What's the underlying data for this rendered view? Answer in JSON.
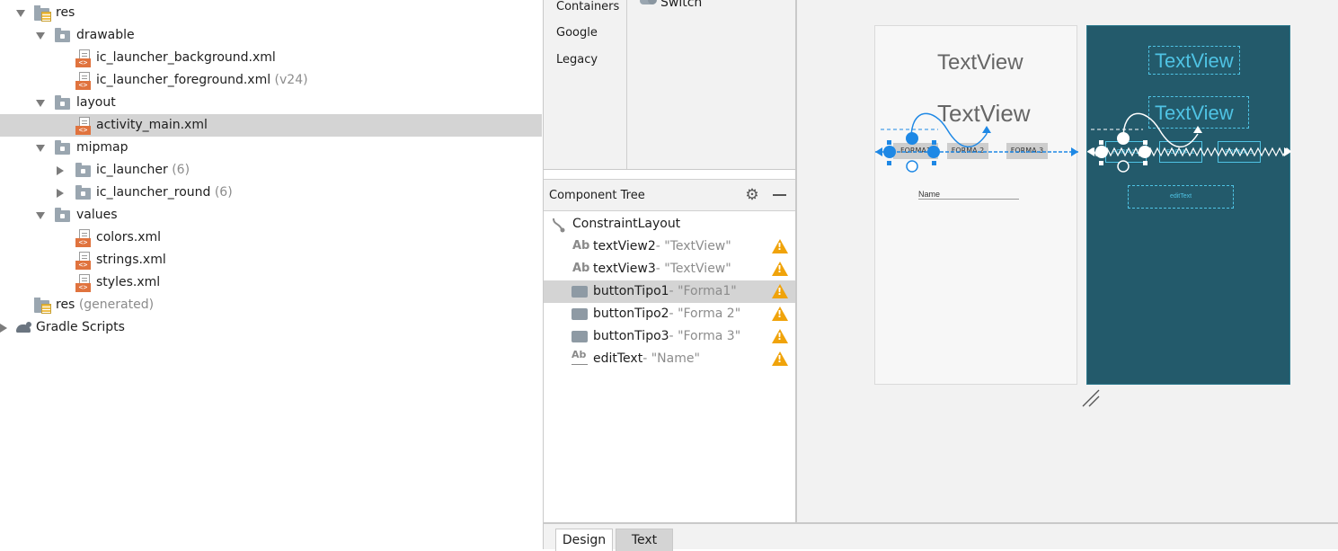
{
  "project_tree": {
    "items": [
      {
        "label": "res",
        "hint": ""
      },
      {
        "label": "drawable",
        "hint": ""
      },
      {
        "label": "ic_launcher_background.xml",
        "hint": ""
      },
      {
        "label": "ic_launcher_foreground.xml",
        "hint": "(v24)"
      },
      {
        "label": "layout",
        "hint": ""
      },
      {
        "label": "activity_main.xml",
        "hint": ""
      },
      {
        "label": "mipmap",
        "hint": ""
      },
      {
        "label": "ic_launcher",
        "hint": "(6)"
      },
      {
        "label": "ic_launcher_round",
        "hint": "(6)"
      },
      {
        "label": "values",
        "hint": ""
      },
      {
        "label": "colors.xml",
        "hint": ""
      },
      {
        "label": "strings.xml",
        "hint": ""
      },
      {
        "label": "styles.xml",
        "hint": ""
      },
      {
        "label": "res",
        "hint": "(generated)"
      },
      {
        "label": "Gradle Scripts",
        "hint": ""
      }
    ],
    "xml_tag": "<>"
  },
  "palette": {
    "categories": [
      "Containers",
      "Google",
      "Legacy"
    ],
    "visible_item": "Switch"
  },
  "component_tree": {
    "title": "Component Tree",
    "root": "ConstraintLayout",
    "ab_glyph": "Ab",
    "rows": [
      {
        "id": "textView2",
        "sep": "- ",
        "value": "\"TextView\""
      },
      {
        "id": "textView3",
        "sep": "- ",
        "value": "\"TextView\""
      },
      {
        "id": "buttonTipo1",
        "sep": "- ",
        "value": "\"Forma1\""
      },
      {
        "id": "buttonTipo2",
        "sep": "- ",
        "value": "\"Forma 2\""
      },
      {
        "id": "buttonTipo3",
        "sep": "- ",
        "value": "\"Forma 3\""
      },
      {
        "id": "editText",
        "sep": "- ",
        "value": "\"Name\""
      }
    ]
  },
  "design": {
    "textview1": "TextView",
    "textview2": "TextView",
    "button1": "FORMA1",
    "button2": "FORMA 2",
    "button3": "FORMA 3",
    "edit_hint": "Name",
    "bp_edit_label": "editText"
  },
  "bottom_tabs": {
    "design": "Design",
    "text": "Text"
  },
  "colors": {
    "selection": "#d4d4d4",
    "blueprint_bg": "#235a6b",
    "blueprint_line": "#4fc3e4",
    "constraint_blue": "#1e88e5",
    "warning": "#f0a30a",
    "xml_orange": "#e0733e"
  },
  "icons": [
    "folder-icon",
    "resource-folder-icon",
    "xml-file-icon",
    "gradle-icon",
    "gear-icon",
    "minus-icon",
    "warning-icon",
    "switch-icon",
    "textview-icon",
    "button-icon",
    "edittext-icon",
    "constraint-layout-icon"
  ]
}
